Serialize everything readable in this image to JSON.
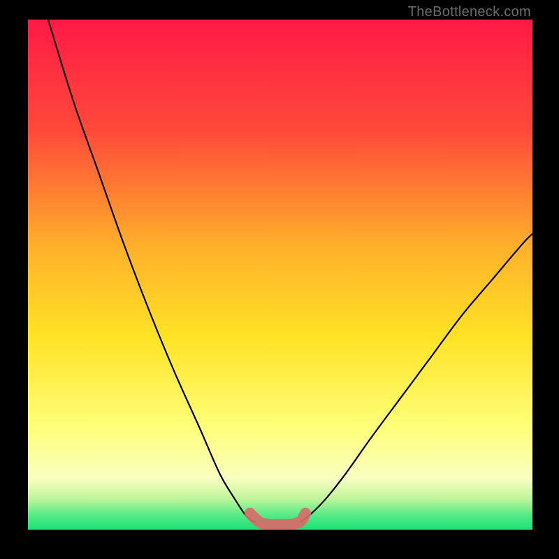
{
  "attribution": "TheBottleneck.com",
  "colors": {
    "top": "#ff1a46",
    "mid_upper": "#ff6a2f",
    "mid": "#ffd820",
    "lower": "#fff7a8",
    "green_a": "#9ef07a",
    "green_b": "#1fe87c",
    "highlight": "#d96a6a",
    "curve": "#000000"
  },
  "chart_data": {
    "type": "line",
    "title": "",
    "xlabel": "",
    "ylabel": "",
    "xlim": [
      0,
      100
    ],
    "ylim": [
      0,
      100
    ],
    "grid": false,
    "legend": false,
    "series": [
      {
        "name": "left-curve",
        "x": [
          4,
          9,
          14,
          19,
          24,
          29,
          34,
          38,
          41,
          43,
          44,
          45
        ],
        "y": [
          100,
          84,
          70,
          56,
          43,
          31,
          20,
          11,
          6,
          3,
          2,
          1.5
        ]
      },
      {
        "name": "right-curve",
        "x": [
          54,
          56,
          59,
          63,
          68,
          74,
          80,
          86,
          92,
          98,
          100
        ],
        "y": [
          1.5,
          3,
          6,
          11,
          18,
          26,
          34,
          42,
          49,
          56,
          58
        ]
      },
      {
        "name": "valley-highlight",
        "x": [
          44,
          46,
          48,
          50,
          52,
          54,
          55
        ],
        "y": [
          3.2,
          1.4,
          1.0,
          1.0,
          1.0,
          1.6,
          3.2
        ]
      }
    ],
    "gradient_stops": [
      {
        "pct": 0,
        "color": "#ff1a46"
      },
      {
        "pct": 22,
        "color": "#ff4a3a"
      },
      {
        "pct": 45,
        "color": "#ffb22a"
      },
      {
        "pct": 62,
        "color": "#ffe225"
      },
      {
        "pct": 80,
        "color": "#ffff7a"
      },
      {
        "pct": 90,
        "color": "#f8ffc0"
      },
      {
        "pct": 94,
        "color": "#bff59a"
      },
      {
        "pct": 97,
        "color": "#5aeb88"
      },
      {
        "pct": 100,
        "color": "#18e276"
      }
    ]
  }
}
